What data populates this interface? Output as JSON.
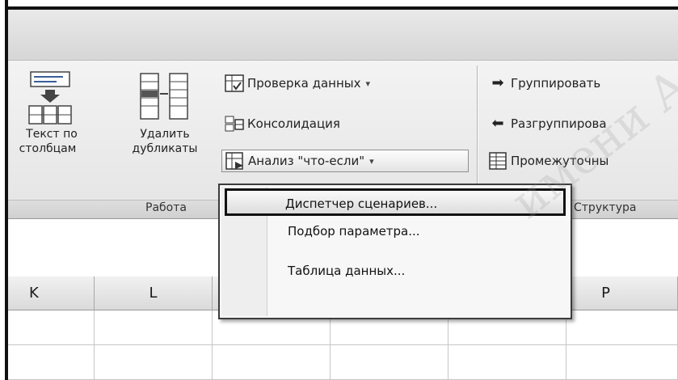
{
  "ribbon": {
    "text_to_columns": {
      "line1": "Текст по",
      "line2": "столбцам"
    },
    "remove_duplicates": {
      "line1": "Удалить",
      "line2": "дубликаты"
    },
    "data_validation": "Проверка данных",
    "consolidate": "Консолидация",
    "whatif": "Анализ \"что-если\"",
    "group_work_label": "Работа",
    "group": "Группировать",
    "ungroup": "Разгруппирова",
    "subtotal": "Промежуточны",
    "group_outline_label": "Структура"
  },
  "columns": [
    "K",
    "L",
    "P"
  ],
  "menu": {
    "items": [
      {
        "label": "Диспетчер сценариев...",
        "highlighted": true
      },
      {
        "label": "Подбор параметра...",
        "highlighted": false
      },
      {
        "label": "Таблица данных...",
        "highlighted": false
      }
    ]
  },
  "watermark": "имени А"
}
